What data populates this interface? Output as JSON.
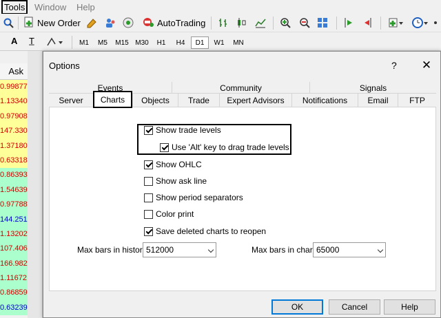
{
  "menu": {
    "tools": "Tools",
    "window": "Window",
    "help": "Help"
  },
  "toolbar": {
    "new_order": "New Order",
    "autotrading": "AutoTrading"
  },
  "timeframes": [
    "M1",
    "M5",
    "M15",
    "M30",
    "H1",
    "H4",
    "D1",
    "W1",
    "MN"
  ],
  "selected_timeframe": "D1",
  "market_watch": {
    "column_header": "Ask",
    "rows": [
      {
        "value": "0.99877",
        "bg": "#ffff99",
        "color": "#d40000"
      },
      {
        "value": "1.13340",
        "bg": "#ffff99",
        "color": "#d40000"
      },
      {
        "value": "0.97908",
        "bg": "#ffff99",
        "color": "#d40000"
      },
      {
        "value": "147.330",
        "bg": "#ffff99",
        "color": "#d40000"
      },
      {
        "value": "1.37180",
        "bg": "#ffff99",
        "color": "#d40000"
      },
      {
        "value": "0.63318",
        "bg": "#ffff99",
        "color": "#d40000"
      },
      {
        "value": "0.86393",
        "bg": "#aaffcc",
        "color": "#d40000"
      },
      {
        "value": "1.54639",
        "bg": "#aaffcc",
        "color": "#d40000"
      },
      {
        "value": "0.97788",
        "bg": "#aaffcc",
        "color": "#d40000"
      },
      {
        "value": "144.251",
        "bg": "#aaffcc",
        "color": "#0000cc"
      },
      {
        "value": "1.13202",
        "bg": "#aaffcc",
        "color": "#d40000"
      },
      {
        "value": "107.406",
        "bg": "#aaffcc",
        "color": "#d40000"
      },
      {
        "value": "166.982",
        "bg": "#aaffcc",
        "color": "#d40000"
      },
      {
        "value": "1.11672",
        "bg": "#aaffcc",
        "color": "#d40000"
      },
      {
        "value": "0.86859",
        "bg": "#aaffcc",
        "color": "#d40000"
      },
      {
        "value": "0.63239",
        "bg": "#aaffcc",
        "color": "#0000cc"
      }
    ]
  },
  "dialog": {
    "title": "Options",
    "help": "?",
    "close": "✕",
    "tab_groups": [
      "Events",
      "Community",
      "Signals"
    ],
    "tabs": [
      "Server",
      "Charts",
      "Objects",
      "Trade",
      "Expert Advisors",
      "Notifications",
      "Email",
      "FTP"
    ],
    "active_tab": "Charts",
    "checkboxes": [
      {
        "label": "Show trade levels",
        "checked": true
      },
      {
        "label": "Use 'Alt' key to drag trade levels",
        "checked": true
      },
      {
        "label": "Show OHLC",
        "checked": true
      },
      {
        "label": "Show ask line",
        "checked": false
      },
      {
        "label": "Show period separators",
        "checked": false
      },
      {
        "label": "Color print",
        "checked": false
      },
      {
        "label": "Save deleted charts to reopen",
        "checked": true
      }
    ],
    "max_bars_history_label": "Max bars in history:",
    "max_bars_history_value": "512000",
    "max_bars_chart_label": "Max bars in chart:",
    "max_bars_chart_value": "65000",
    "buttons": {
      "ok": "OK",
      "cancel": "Cancel",
      "help": "Help"
    }
  }
}
